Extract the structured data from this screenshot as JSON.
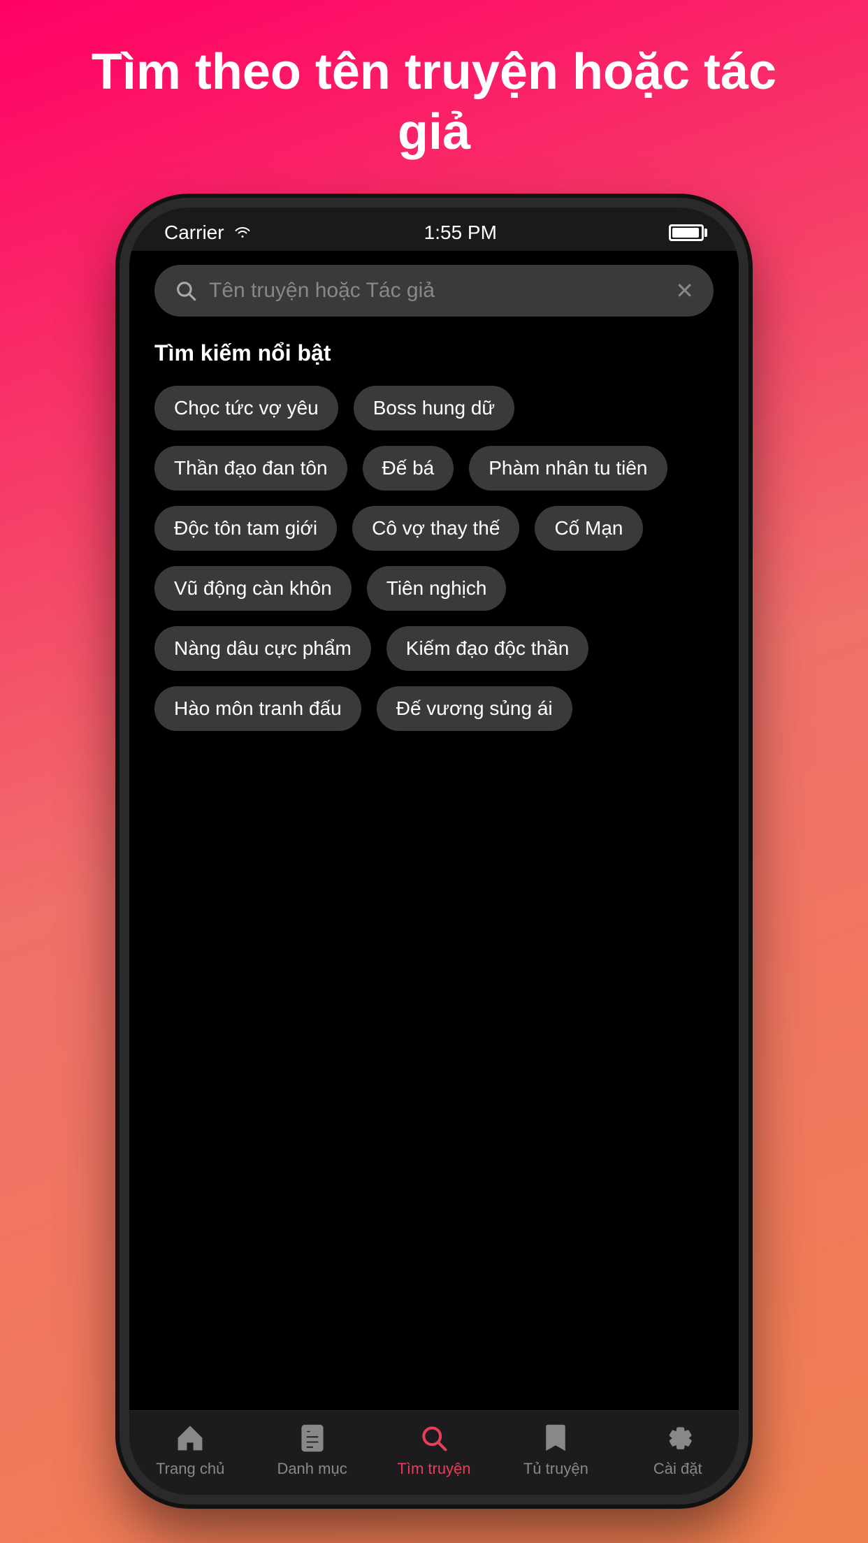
{
  "top_title": "Tìm theo tên truyện hoặc tác giả",
  "status_bar": {
    "carrier": "Carrier",
    "time": "1:55 PM"
  },
  "search": {
    "placeholder": "Tên truyện hoặc Tác giả"
  },
  "section": {
    "title": "Tìm kiếm nổi bật"
  },
  "tags": [
    "Chọc tức vợ yêu",
    "Boss hung dữ",
    "Thần đạo đan tôn",
    "Đế bá",
    "Phàm nhân tu tiên",
    "Độc tôn tam giới",
    "Cô vợ thay thế",
    "Cố Mạn",
    "Vũ động càn khôn",
    "Tiên nghịch",
    "Nàng dâu cực phẩm",
    "Kiếm đạo độc thần",
    "Hào môn tranh đấu",
    "Đế vương sủng ái"
  ],
  "tabs": [
    {
      "label": "Trang chủ",
      "icon": "home",
      "active": false
    },
    {
      "label": "Danh mục",
      "icon": "book",
      "active": false
    },
    {
      "label": "Tìm truyện",
      "icon": "search",
      "active": true
    },
    {
      "label": "Tủ truyện",
      "icon": "bookmark",
      "active": false
    },
    {
      "label": "Cài đặt",
      "icon": "gear",
      "active": false
    }
  ]
}
